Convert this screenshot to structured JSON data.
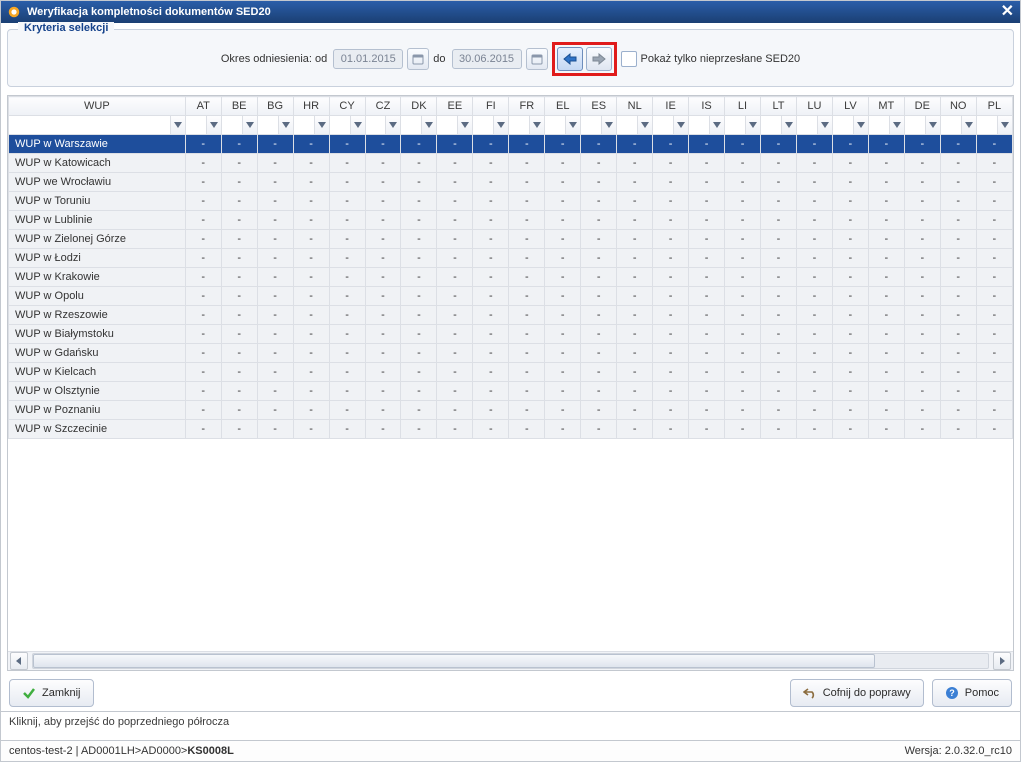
{
  "window": {
    "title": "Weryfikacja kompletności dokumentów SED20"
  },
  "criteria": {
    "legend": "Kryteria selekcji",
    "period_label": "Okres odniesienia: od",
    "date_from": "01.01.2015",
    "to_label": "do",
    "date_to": "30.06.2015",
    "checkbox_label": "Pokaż tylko nieprzesłane SED20"
  },
  "table": {
    "name_header": "WUP",
    "columns": [
      "AT",
      "BE",
      "BG",
      "HR",
      "CY",
      "CZ",
      "DK",
      "EE",
      "FI",
      "FR",
      "EL",
      "ES",
      "NL",
      "IE",
      "IS",
      "LI",
      "LT",
      "LU",
      "LV",
      "MT",
      "DE",
      "NO",
      "PL"
    ],
    "rows": [
      {
        "name": "WUP w Warszawie",
        "selected": true
      },
      {
        "name": "WUP w Katowicach"
      },
      {
        "name": "WUP we Wrocławiu"
      },
      {
        "name": "WUP w Toruniu"
      },
      {
        "name": "WUP w Lublinie"
      },
      {
        "name": "WUP w Zielonej Górze"
      },
      {
        "name": "WUP w Łodzi"
      },
      {
        "name": "WUP w Krakowie"
      },
      {
        "name": "WUP w Opolu"
      },
      {
        "name": "WUP w Rzeszowie"
      },
      {
        "name": "WUP w Białymstoku"
      },
      {
        "name": "WUP w Gdańsku"
      },
      {
        "name": "WUP w Kielcach"
      },
      {
        "name": "WUP w Olsztynie"
      },
      {
        "name": "WUP w Poznaniu"
      },
      {
        "name": "WUP w Szczecinie"
      }
    ],
    "cell_value": "-"
  },
  "buttons": {
    "close": "Zamknij",
    "revert": "Cofnij do poprawy",
    "help": "Pomoc"
  },
  "status": {
    "hint": "Kliknij, aby przejść do poprzedniego półrocza"
  },
  "footer": {
    "env": "centos-test-2 | AD0001LH>AD0000>",
    "code": "KS0008L",
    "version_label": "Wersja:",
    "version": "2.0.32.0_rc10"
  }
}
